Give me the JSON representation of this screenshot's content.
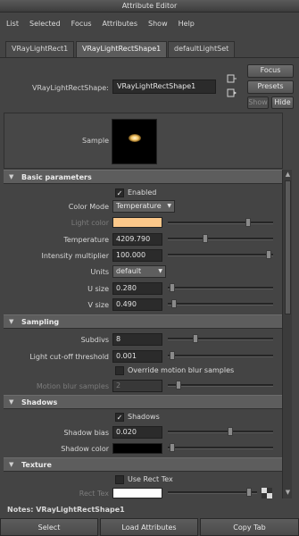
{
  "window": {
    "title": "Attribute Editor"
  },
  "menu": [
    "List",
    "Selected",
    "Focus",
    "Attributes",
    "Show",
    "Help"
  ],
  "tabs": [
    {
      "label": "VRayLightRect1",
      "active": false
    },
    {
      "label": "VRayLightRectShape1",
      "active": true
    },
    {
      "label": "defaultLightSet",
      "active": false
    }
  ],
  "node": {
    "label": "VRayLightRectShape:",
    "value": "VRayLightRectShape1"
  },
  "side_buttons": {
    "focus": "Focus",
    "presets": "Presets",
    "show": "Show",
    "hide": "Hide"
  },
  "sample": {
    "label": "Sample"
  },
  "basic": {
    "header": "Basic parameters",
    "enabled_label": "Enabled",
    "enabled": true,
    "color_mode_label": "Color Mode",
    "color_mode_value": "Temperature",
    "light_color_label": "Light color",
    "light_color": "#fcc88a",
    "temperature_label": "Temperature",
    "temperature_value": "4209.790",
    "temperature_slider": 0.35,
    "intensity_label": "Intensity multiplier",
    "intensity_value": "100.000",
    "intensity_slider": 0.98,
    "units_label": "Units",
    "units_value": "default",
    "usize_label": "U size",
    "usize_value": "0.280",
    "usize_slider": 0.02,
    "vsize_label": "V size",
    "vsize_value": "0.490",
    "vsize_slider": 0.04
  },
  "sampling": {
    "header": "Sampling",
    "subdivs_label": "Subdivs",
    "subdivs_value": "8",
    "subdivs_slider": 0.25,
    "cutoff_label": "Light cut-off threshold",
    "cutoff_value": "0.001",
    "cutoff_slider": 0.02,
    "override_label": "Override motion blur samples",
    "override": false,
    "motionblur_label": "Motion blur samples",
    "motionblur_value": "2",
    "motionblur_slider": 0.08
  },
  "shadows": {
    "header": "Shadows",
    "shadows_label": "Shadows",
    "shadows": true,
    "bias_label": "Shadow bias",
    "bias_value": "0.020",
    "bias_slider": 0.6,
    "color_label": "Shadow color",
    "shadow_color": "#000000",
    "color_slider": 0.02
  },
  "texture": {
    "header": "Texture",
    "use_label": "Use Rect Tex",
    "use": false,
    "recttex_label": "Rect Tex",
    "recttex_color": "#ffffff",
    "recttex_slider": 0.97
  },
  "notes": {
    "label": "Notes:  VRayLightRectShape1"
  },
  "bottom_buttons": {
    "select": "Select",
    "load": "Load Attributes",
    "copy": "Copy Tab"
  }
}
